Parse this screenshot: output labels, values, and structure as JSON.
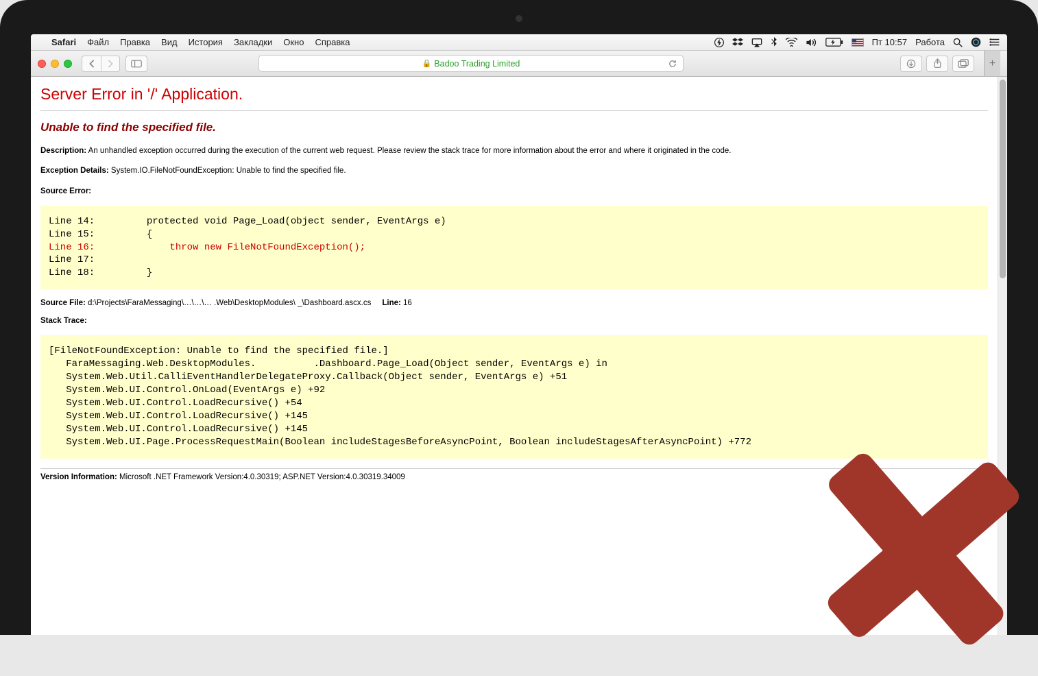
{
  "menubar": {
    "app": "Safari",
    "items": [
      "Файл",
      "Правка",
      "Вид",
      "История",
      "Закладки",
      "Окно",
      "Справка"
    ],
    "clock": "Пт 10:57",
    "user": "Работа"
  },
  "toolbar": {
    "url_label": "Badoo Trading Limited"
  },
  "error": {
    "title": "Server Error in '/' Application.",
    "subtitle": "Unable to find the specified file.",
    "description_label": "Description:",
    "description_text": "An unhandled exception occurred during the execution of the current web request. Please review the stack trace for more information about the error and where it originated in the code.",
    "exception_label": "Exception Details:",
    "exception_text": "System.IO.FileNotFoundException: Unable to find the specified file.",
    "source_error_label": "Source Error:",
    "source_lines": {
      "l14": "Line 14:         protected void Page_Load(object sender, EventArgs e)",
      "l15": "Line 15:         {",
      "l16": "Line 16:             throw new FileNotFoundException();",
      "l17": "Line 17:",
      "l18": "Line 18:         }"
    },
    "source_file_label": "Source File:",
    "source_file_text": "d:\\Projects\\FaraMessaging\\…\\…\\…           .Web\\DesktopModules\\           _\\Dashboard.ascx.cs",
    "line_label": "Line:",
    "line_num": "16",
    "stack_trace_label": "Stack Trace:",
    "stack_trace": "[FileNotFoundException: Unable to find the specified file.]\n   FaraMessaging.Web.DesktopModules.          .Dashboard.Page_Load(Object sender, EventArgs e) in \n   System.Web.Util.CalliEventHandlerDelegateProxy.Callback(Object sender, EventArgs e) +51\n   System.Web.UI.Control.OnLoad(EventArgs e) +92\n   System.Web.UI.Control.LoadRecursive() +54\n   System.Web.UI.Control.LoadRecursive() +145\n   System.Web.UI.Control.LoadRecursive() +145\n   System.Web.UI.Page.ProcessRequestMain(Boolean includeStagesBeforeAsyncPoint, Boolean includeStagesAfterAsyncPoint) +772",
    "version_label": "Version Information:",
    "version_text": "Microsoft .NET Framework Version:4.0.30319; ASP.NET Version:4.0.30319.34009"
  }
}
